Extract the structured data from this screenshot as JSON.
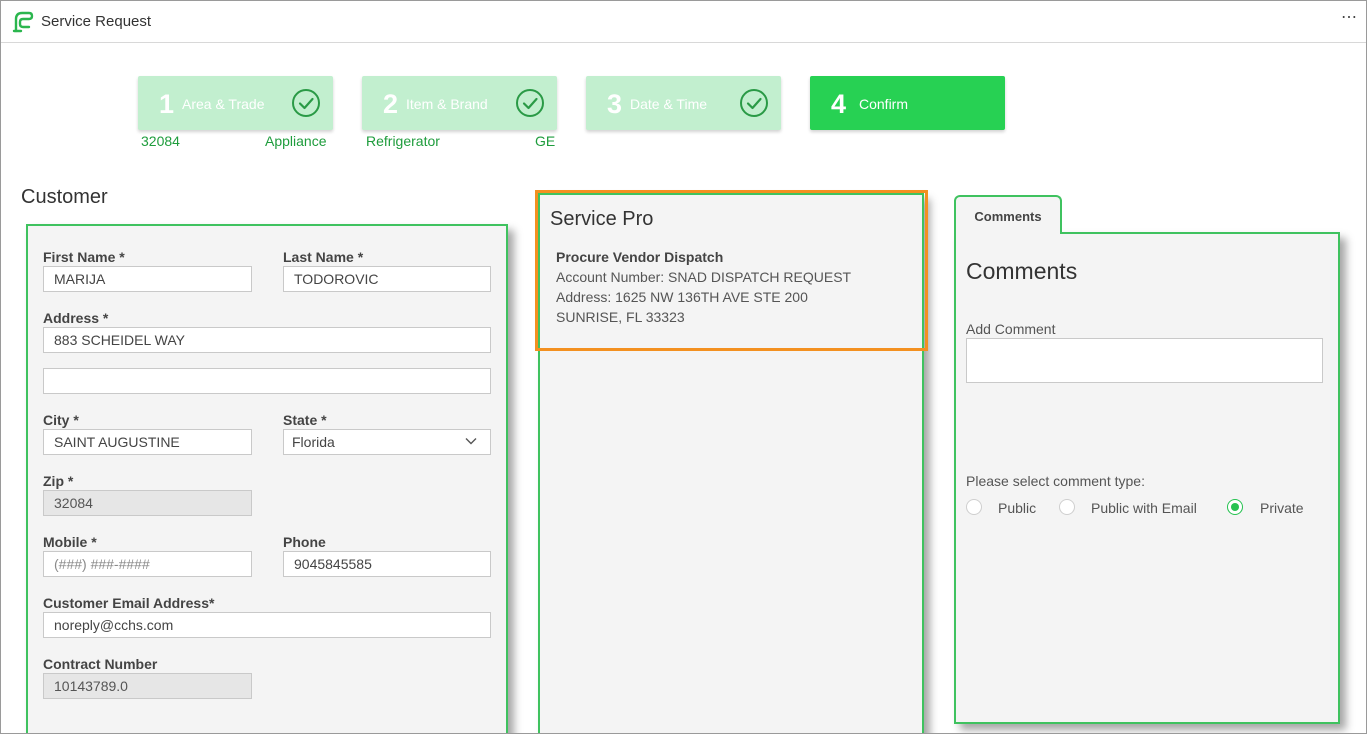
{
  "header": {
    "title": "Service Request",
    "more_glyph": "⋯"
  },
  "steps": [
    {
      "num": "1",
      "label": "Area & Trade",
      "done": true,
      "sub_left": "32084",
      "sub_right": "Appliance"
    },
    {
      "num": "2",
      "label": "Item & Brand",
      "done": true,
      "sub_left": "Refrigerator",
      "sub_right": "GE"
    },
    {
      "num": "3",
      "label": "Date & Time",
      "done": true
    },
    {
      "num": "4",
      "label": "Confirm",
      "done": false,
      "active": true
    }
  ],
  "customer": {
    "heading": "Customer",
    "first_name_label": "First Name *",
    "first_name": "MARIJA",
    "last_name_label": "Last Name *",
    "last_name": "TODOROVIC",
    "address_label": "Address *",
    "address1": "883 SCHEIDEL WAY",
    "address2": "",
    "city_label": "City *",
    "city": "SAINT AUGUSTINE",
    "state_label": "State *",
    "state": "Florida",
    "zip_label": "Zip *",
    "zip": "32084",
    "mobile_label": "Mobile *",
    "mobile_placeholder": "(###) ###-####",
    "phone_label": "Phone",
    "phone": "9045845585",
    "email_label": "Customer Email Address*",
    "email": "noreply@cchs.com",
    "contract_label": "Contract Number",
    "contract": "10143789.0"
  },
  "service_pro": {
    "heading": "Service Pro",
    "name": "Procure Vendor Dispatch",
    "account": "Account Number: SNAD DISPATCH REQUEST",
    "address": "Address: 1625 NW 136TH AVE STE 200",
    "city_line": "SUNRISE, FL 33323"
  },
  "comments": {
    "tab_label": "Comments",
    "heading": "Comments",
    "add_label": "Add Comment",
    "comment_value": "",
    "type_prompt": "Please select comment type:",
    "options": [
      "Public",
      "Public with Email",
      "Private"
    ],
    "selected": "Private"
  },
  "colors": {
    "accent": "#27d153",
    "step_done": "#c2efcf",
    "panel_border": "#3fc25f",
    "highlight": "#f39020",
    "sub_text": "#1e9c3c"
  }
}
